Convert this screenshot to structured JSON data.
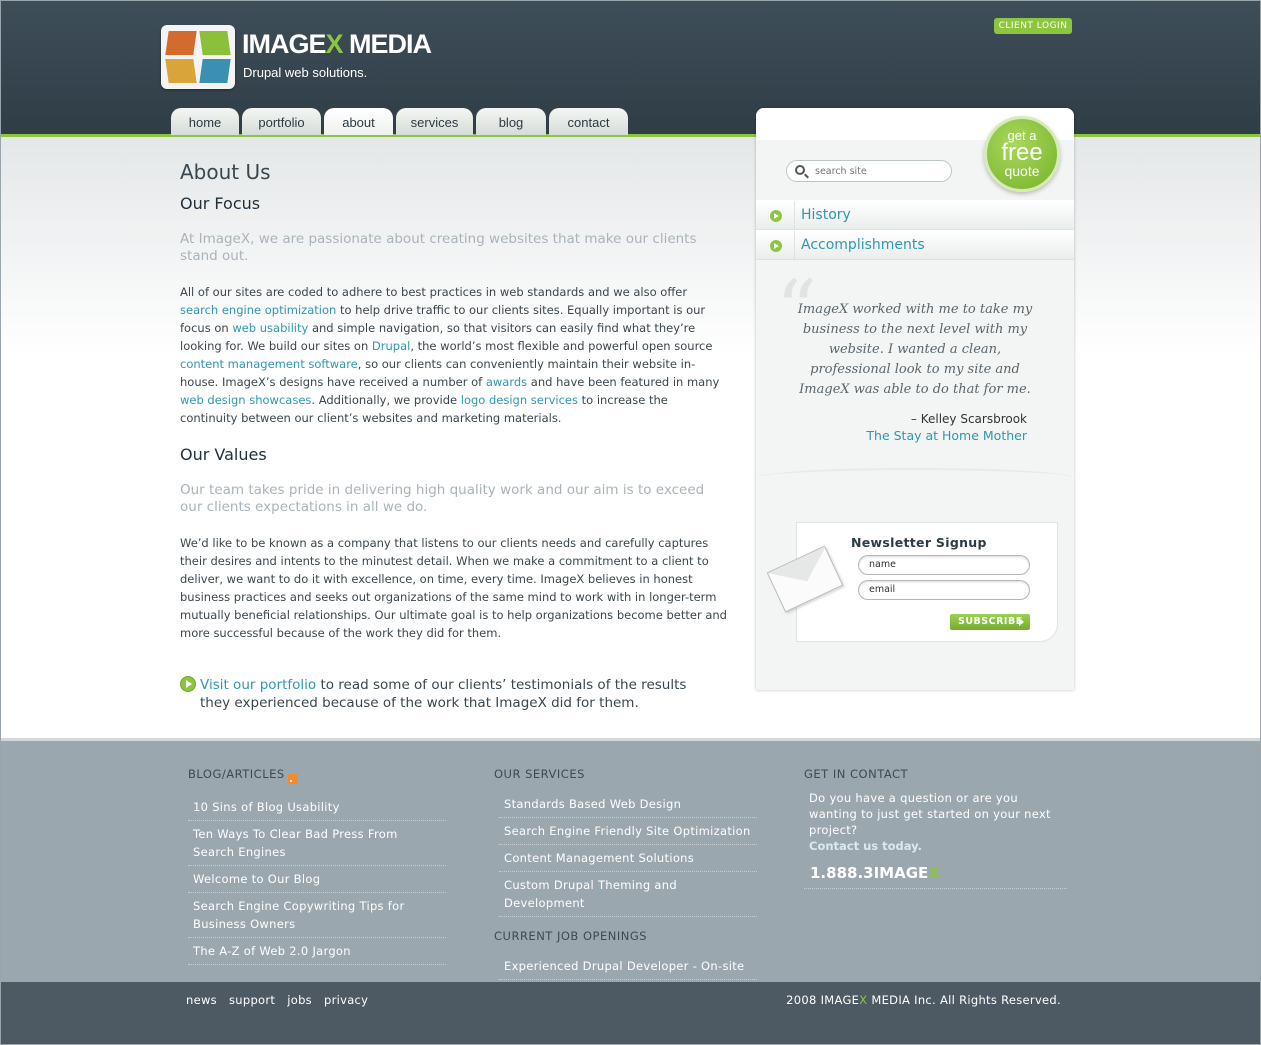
{
  "header": {
    "logo_name_pre": "IMAGE",
    "logo_name_x": "X",
    "logo_name_post": " MEDIA",
    "tagline": "Drupal web solutions.",
    "client_login": "CLIENT LOGIN",
    "nav": [
      "home",
      "portfolio",
      "about",
      "services",
      "blog",
      "contact"
    ],
    "active_nav": "about"
  },
  "main": {
    "title": "About Us",
    "focus_heading": "Our Focus",
    "focus_lead": "At ImageX, we are passionate about creating websites that make our clients stand out.",
    "focus_para": {
      "t1": "All of our sites are coded to adhere to best practices in web standards and we also offer ",
      "l1": "search engine optimization",
      "t2": " to help drive traffic to our clients sites. Equally important is our focus on ",
      "l2": "web usability",
      "t3": " and simple navigation, so that visitors can easily find what they’re looking for. We build our sites on ",
      "l3": "Drupal",
      "t4": ", the world’s most flexible and powerful open source ",
      "l4": "content management software",
      "t5": ", so our clients can conveniently maintain their website in-house. ImageX’s designs have received a number of ",
      "l5": "awards",
      "t6": " and have been featured in many ",
      "l6": "web design showcases",
      "t7": ". Additionally, we provide ",
      "l7": "logo design services",
      "t8": " to increase the continuity between our client’s websites and marketing materials."
    },
    "values_heading": "Our Values",
    "values_lead": "Our team takes pride in delivering high quality work and our aim is to exceed our clients expectations in all we do.",
    "values_para": "We’d like to be known as a company that listens to our clients needs and carefully captures their desires and intents to the minutest detail. When we make a commitment to a client to deliver, we want to do it with excellence, on time, every time. ImageX believes in honest business practices and seeks out organizations of the same mind to work with in longer-term mutually beneficial relationships. Our ultimate goal is to help organizations become better and more successful because of the work they did for them.",
    "cta_link": "Visit our portfolio",
    "cta_text": " to read some of our clients’ testimonials of the results they experienced because of the work that ImageX did for them."
  },
  "sidebar": {
    "search_placeholder": "search site",
    "quote_get": "get a",
    "quote_free": "free",
    "quote_quote": "quote",
    "menu": [
      "History",
      "Accomplishments"
    ],
    "testimonial_text": "ImageX worked with me to take my business to the next level with my website. I wanted a clean, professional look to my site and ImageX was able to do that for me.",
    "testimonial_author": "– Kelley Scarsbrook",
    "testimonial_org": "The Stay at Home Mother",
    "newsletter_title": "Newsletter Signup",
    "name_placeholder": "name",
    "email_placeholder": "email",
    "subscribe_label": "SUBSCRIBE"
  },
  "footer": {
    "blog_heading": "BLOG/ARTICLES",
    "blog_items": [
      "10 Sins of Blog Usability",
      "Ten Ways To Clear Bad Press From Search Engines",
      "Welcome to Our Blog",
      "Search Engine Copywriting Tips for Business Owners",
      "The A-Z of Web 2.0 Jargon"
    ],
    "services_heading": "OUR SERVICES",
    "services_items": [
      "Standards Based Web Design",
      "Search Engine Friendly Site Optimization",
      "Content Management Solutions",
      "Custom Drupal Theming and Development"
    ],
    "jobs_heading": "CURRENT JOB OPENINGS",
    "jobs_items": [
      "Experienced Drupal Developer - On-site"
    ],
    "contact_heading": "GET IN CONTACT",
    "contact_text": "Do you have a question or are you wanting to just get started on your next project?",
    "contact_link": "Contact us today.",
    "phone_pre": "1.888.3IMAGE",
    "phone_x": "X",
    "bottom_links": [
      "news",
      "support",
      "jobs",
      "privacy"
    ],
    "copyright_pre": "2008 IMAGE",
    "copyright_x": "X",
    "copyright_post": " MEDIA Inc. All Rights Reserved."
  },
  "colors": {
    "accent_green": "#8cc63e",
    "link_blue": "#2f97b3",
    "header_dark": "#34434d",
    "footer_grey": "#9ba7af",
    "bottom_bar": "#4d5a63"
  }
}
